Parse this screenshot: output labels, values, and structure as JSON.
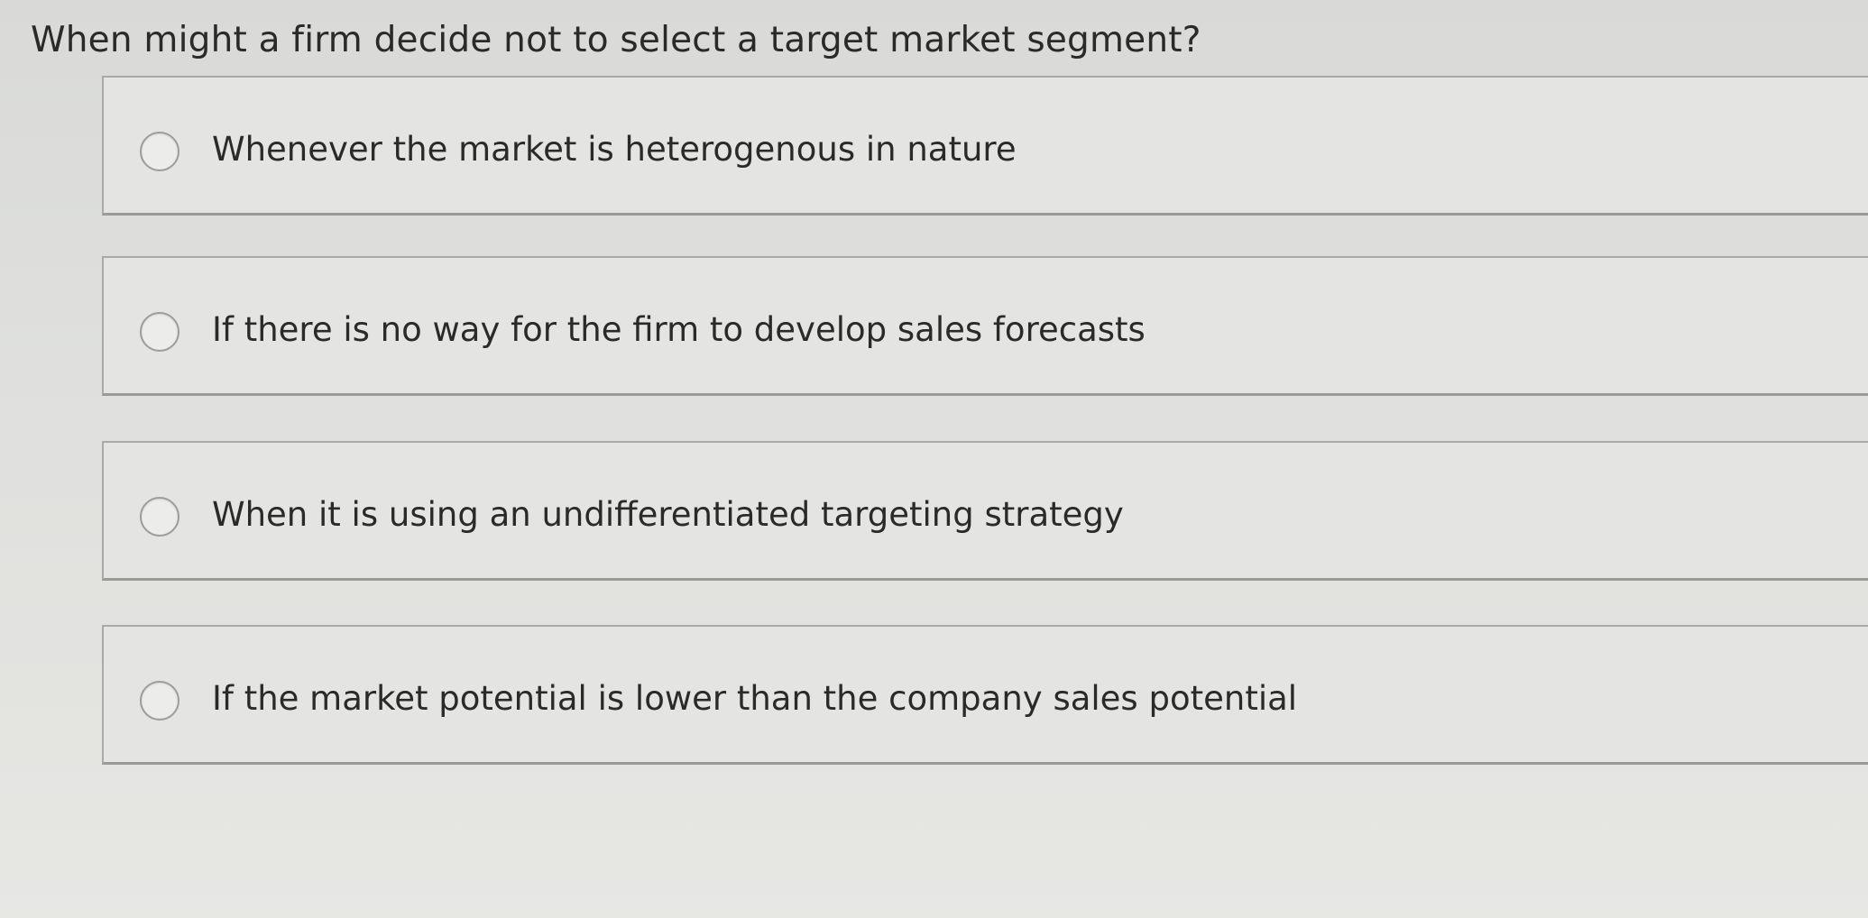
{
  "question": {
    "text": "When might a firm decide not to select a target market segment?"
  },
  "options": [
    {
      "label": "Whenever the market is heterogenous in nature",
      "selected": false
    },
    {
      "label": "If there is no way for the firm to develop sales forecasts",
      "selected": false
    },
    {
      "label": "When it is using an undifferentiated targeting strategy",
      "selected": false
    },
    {
      "label": "If the market potential is lower than the company sales potential",
      "selected": false
    }
  ],
  "colors": {
    "background": "#dcdddb",
    "option_background": "#e4e5e2",
    "border": "#a9aaa7",
    "text": "#2a2a2a"
  }
}
